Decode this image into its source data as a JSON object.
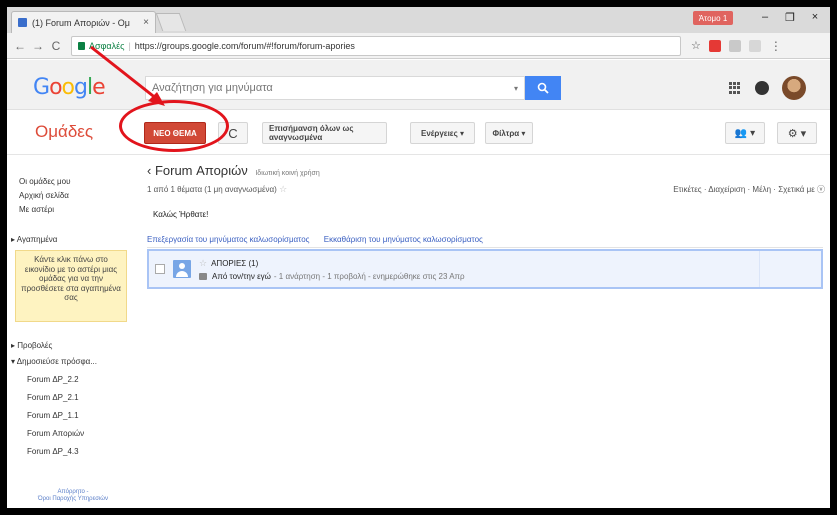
{
  "browser": {
    "tab_title": "(1) Forum Απορ​ιών - Ομ",
    "tab_close": "×",
    "user_badge": "Άτομο 1",
    "win_minimize": "–",
    "win_maximize": "❐",
    "win_close": "×",
    "back": "←",
    "forward": "→",
    "reload": "C",
    "secure_label": "Ασφαλές",
    "url": "https://groups.google.com/forum/#!forum/forum-apories",
    "bookmark_star": "☆",
    "menu": "⋮"
  },
  "header": {
    "logo_letters": [
      "G",
      "o",
      "o",
      "g",
      "l",
      "e"
    ],
    "search_placeholder": "Αναζήτηση για μηνύματα",
    "search_button_icon": "search-icon",
    "colors": {
      "accent_blue": "#4285f4",
      "brand_red": "#dd4b39",
      "new_topic_red": "#d14836"
    }
  },
  "toolbar": {
    "groups_title": "Ομάδες",
    "new_topic": "ΝΕΟ ΘΕΜΑ",
    "refresh": "C",
    "mark_all_read": "Επισήμανση όλων ως αναγνωσμένα",
    "actions": "Ενέργειες ▾",
    "filters": "Φίλτρα ▾",
    "members_icon": "👥 ▾",
    "settings_icon": "⚙ ▾"
  },
  "sidebar": {
    "items": [
      {
        "label": "Οι ομάδες μου"
      },
      {
        "label": "Αρχική σελίδα"
      },
      {
        "label": "Με αστέρι"
      }
    ],
    "favorites_header": "▸ Αγαπημένα",
    "favorites_hint": "Κάντε κλικ πάνω στο εικονίδιο με το αστέρι μιας ομάδας για να την προσθέσετε στα αγαπημένα σας",
    "views_header": "▸ Προβολές",
    "recent_header": "▾ Δημοσιεύσε πρόσφα...",
    "recent": [
      {
        "label": "Forum ΔΡ_2.2"
      },
      {
        "label": "Forum ΔΡ_2.1"
      },
      {
        "label": "Forum ΔΡ_1.1"
      },
      {
        "label": "Forum Απορ​ιών"
      },
      {
        "label": "Forum ΔΡ_4.3"
      }
    ],
    "footer_line1": "Απόρρητο -",
    "footer_line2": "Όροι Παροχής Υπηρεσιών"
  },
  "main": {
    "forum_name": "‹ Forum Απορ​ιών",
    "forum_privacy": "Ιδιωτική κοινή χρήση",
    "topic_count": "1 από 1 θέματα (1 μη αναγνωσμένα)",
    "topic_count_star": "☆",
    "right_links": "Ετικέτες · Διαχείριση · Μέλη · Σχετικά με ⓥ",
    "welcome": "Καλώς Ήρθατε!",
    "edit_welcome": "Επεξεργασία του μηνύματος καλωσορίσματος",
    "clear_welcome": "Εκκαθάριση του μηνύματος καλωσορίσματος",
    "topic": {
      "star": "☆",
      "title": "ΑΠΟΡΙΕΣ (1)",
      "author": "Από τον/την εγώ",
      "stats": "- 1 ανάρτηση - 1 προβολή - ενημερώθηκε στις 23 Απρ"
    }
  }
}
